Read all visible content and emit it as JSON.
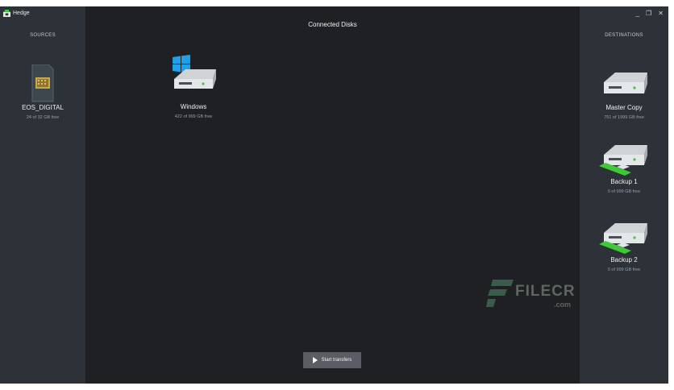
{
  "window": {
    "title": "Hedge",
    "controls": {
      "minimize": "_",
      "restore": "❐",
      "close": "✕"
    }
  },
  "sources": {
    "label": "SOURCES",
    "items": [
      {
        "name": "EOS_DIGITAL",
        "free": "24 of 32 GB free",
        "icon": "sd-card-icon"
      }
    ]
  },
  "main": {
    "title": "Connected Disks",
    "disks": [
      {
        "name": "Windows",
        "free": "422 of 999 GB free",
        "icon": "windows-drive-icon"
      }
    ],
    "start_button": "Start transfers"
  },
  "destinations": {
    "label": "DESTINATIONS",
    "items": [
      {
        "name": "Master Copy",
        "free": "751 of 1999 GB free",
        "icon": "hard-drive-icon"
      },
      {
        "name": "Backup 1",
        "free": "0 of 999 GB free",
        "icon": "network-drive-icon"
      },
      {
        "name": "Backup 2",
        "free": "0 of 999 GB free",
        "icon": "network-drive-icon"
      }
    ]
  },
  "watermark": {
    "text": "FILECR",
    "suffix": ".com"
  },
  "colors": {
    "background": "#1e2024",
    "panel": "#2d3138",
    "button": "#5a5e64",
    "windows_blue": "#1fa0e8",
    "network_green": "#3ec83a"
  }
}
